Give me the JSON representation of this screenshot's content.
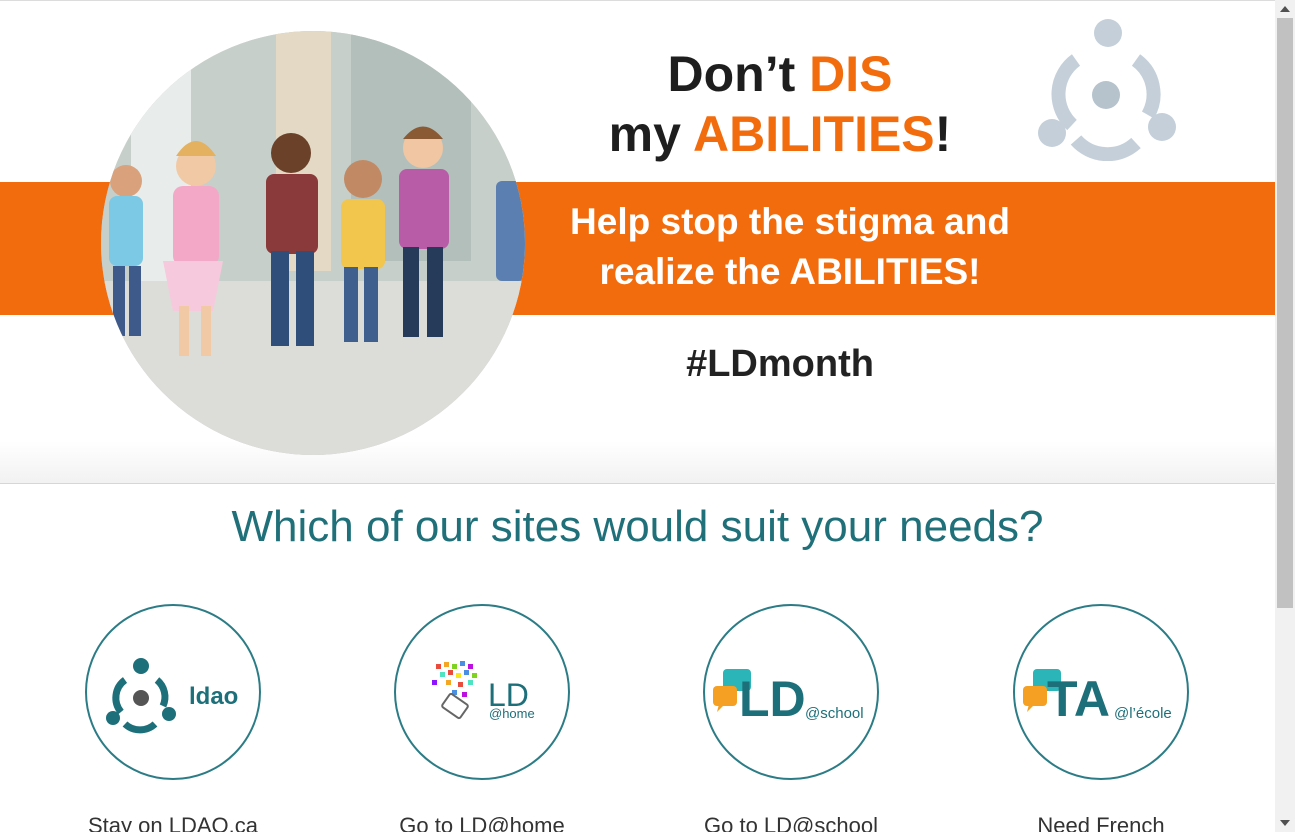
{
  "banner": {
    "headline_pre": "Don’t ",
    "headline_accent": "DIS",
    "line2_pre": "my ",
    "line2_accent": "ABILITIES",
    "line2_post": "!",
    "tagline_line1": "Help stop the stigma and",
    "tagline_line2": "realize the ABILITIES!",
    "hashtag": "#LDmonth",
    "photo_icon": "children-running-photo",
    "logo_icon": "ldao-logo-mark"
  },
  "section": {
    "title": "Which of our sites would suit your needs?"
  },
  "sites": [
    {
      "label": "Stay on LDAO.ca",
      "logo_text": "ldao",
      "logo_icon": "ldao-logo"
    },
    {
      "label": "Go to LD@home",
      "logo_text": "LD",
      "logo_sub": "@home",
      "logo_icon": "ld-at-home-logo"
    },
    {
      "label": "Go to LD@school",
      "logo_text": "LD",
      "logo_sub": "@school",
      "logo_icon": "ld-at-school-logo"
    },
    {
      "label": "Need French",
      "logo_text": "TA",
      "logo_sub": "@l’école",
      "logo_icon": "ta-at-lecole-logo"
    }
  ],
  "colors": {
    "orange": "#f26c0d",
    "teal": "#20707a",
    "logo_teal": "#1d6f7a",
    "speech_orange": "#f5a023",
    "speech_teal": "#2bb5b8"
  }
}
